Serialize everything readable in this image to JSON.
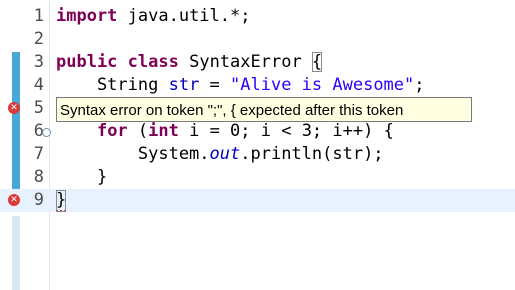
{
  "editor": {
    "lines": [
      {
        "num": "1",
        "text": "import java.util.*;"
      },
      {
        "num": "2",
        "text": ""
      },
      {
        "num": "3",
        "text": "public class SyntaxError {"
      },
      {
        "num": "4",
        "text": "    String str = \"Alive is Awesome\";"
      },
      {
        "num": "5",
        "text": "    {"
      },
      {
        "num": "6",
        "text": "    for (int i = 0; i < 3; i++) {"
      },
      {
        "num": "7",
        "text": "        System.out.println(str);"
      },
      {
        "num": "8",
        "text": "    }"
      },
      {
        "num": "9",
        "text": "}"
      }
    ],
    "tokens": {
      "l1_kw": "import",
      "l1_rest": " java.util.*;",
      "l3_kw1": "public",
      "l3_kw2": "class",
      "l3_name": " SyntaxError ",
      "l3_brace": "{",
      "l4_type": "    String ",
      "l4_field": "str",
      "l4_eq": " = ",
      "l4_str": "\"Alive is Awesome\"",
      "l4_semi": ";",
      "l6_indent": "    ",
      "l6_for": "for",
      "l6_mid1": " (",
      "l6_int": "int",
      "l6_rest": " i = 0; i < 3; i++) {",
      "l7_indent": "        System.",
      "l7_out": "out",
      "l7_rest": ".println(str);",
      "l8_text": "    }",
      "l9_text": "}"
    }
  },
  "markers": {
    "error_icon": "error-x-icon",
    "fold_icon": "fold-collapse-icon"
  },
  "tooltip": {
    "text": "Syntax error on token \";\", { expected after this token"
  },
  "colors": {
    "keyword": "#7f0055",
    "string": "#2a00ff",
    "field": "#0000c0",
    "error": "#d93a3a",
    "tooltip_bg": "#ffffe1",
    "current_line": "#e8f2fe"
  }
}
